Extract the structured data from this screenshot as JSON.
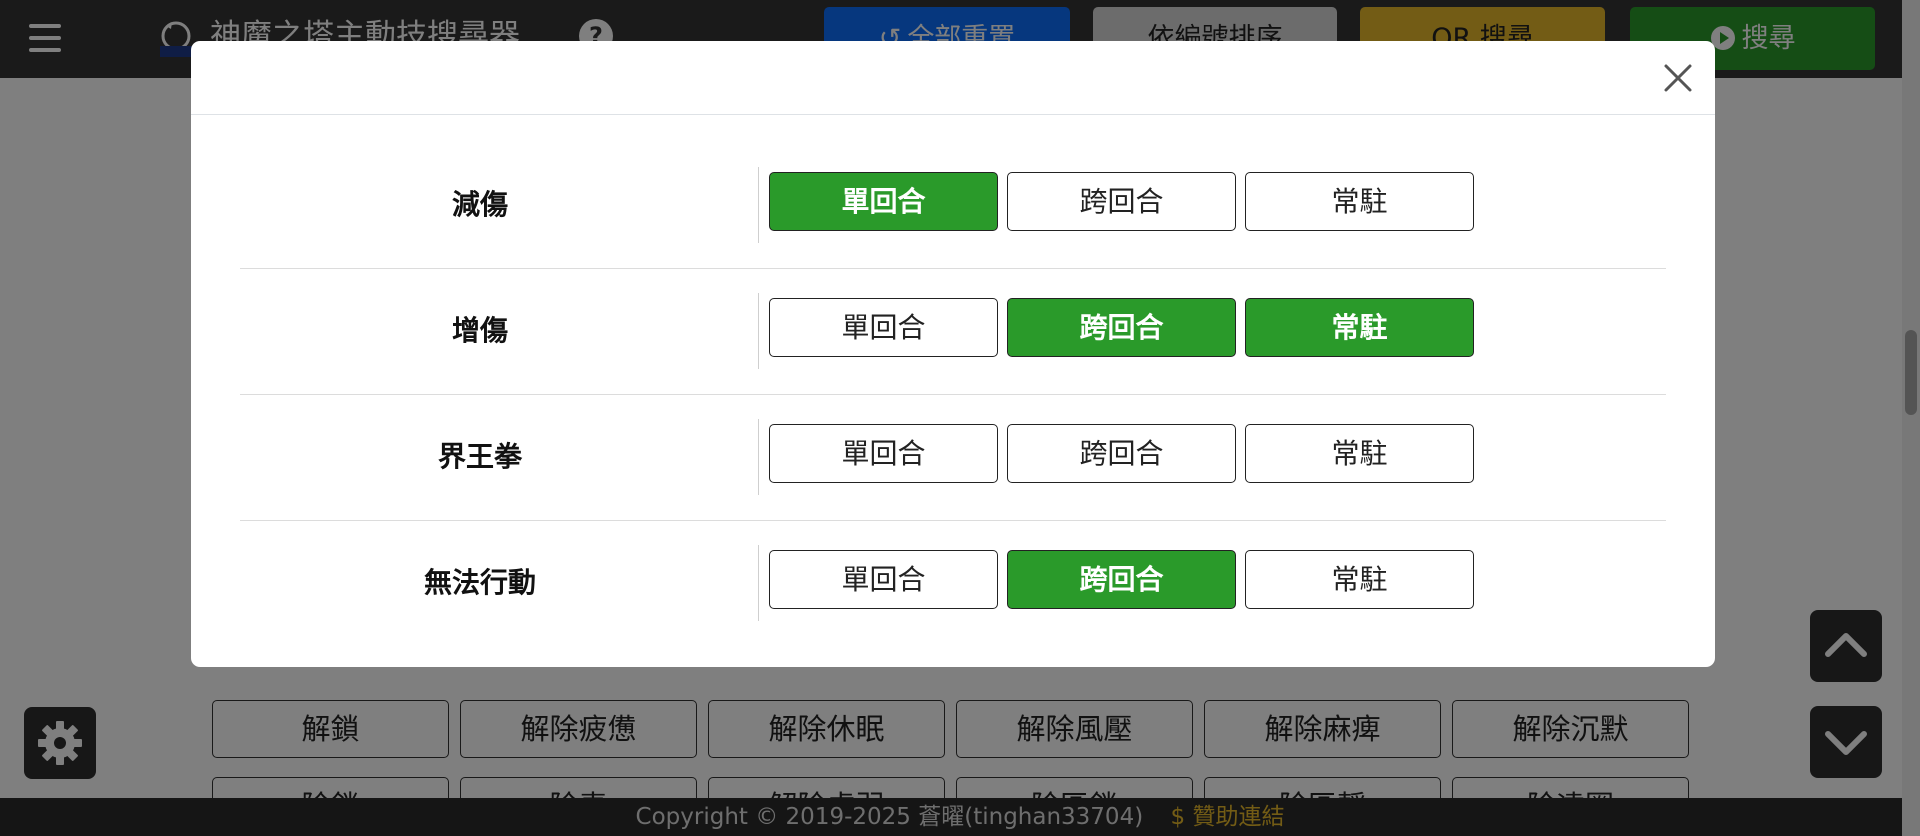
{
  "header": {
    "app_title": "神魔之塔主動技搜尋器",
    "help_symbol": "?",
    "buttons": {
      "reset": "全部重置",
      "sort": "依編號排序",
      "or_search": "OR 搜尋",
      "search": "搜尋"
    }
  },
  "skill_buttons": [
    [
      "解鎖",
      "解除疲憊",
      "解除休眠",
      "解除風壓",
      "解除麻痺",
      "解除沉默"
    ],
    [
      "除鎖",
      "除毒",
      "解除虛弱",
      "除區鎖",
      "除區靜",
      "除遠圈"
    ]
  ],
  "footer": {
    "copyright": "Copyright © 2019-2025 蒼曜(tinghan33704)",
    "sponsor_symbol": "$",
    "sponsor": "贊助連結"
  },
  "modal": {
    "rows": [
      {
        "label": "減傷",
        "options": [
          {
            "label": "單回合",
            "selected": true
          },
          {
            "label": "跨回合",
            "selected": false
          },
          {
            "label": "常駐",
            "selected": false
          }
        ]
      },
      {
        "label": "增傷",
        "options": [
          {
            "label": "單回合",
            "selected": false
          },
          {
            "label": "跨回合",
            "selected": true
          },
          {
            "label": "常駐",
            "selected": true
          }
        ]
      },
      {
        "label": "界王拳",
        "options": [
          {
            "label": "單回合",
            "selected": false
          },
          {
            "label": "跨回合",
            "selected": false
          },
          {
            "label": "常駐",
            "selected": false
          }
        ]
      },
      {
        "label": "無法行動",
        "options": [
          {
            "label": "單回合",
            "selected": false
          },
          {
            "label": "跨回合",
            "selected": true
          },
          {
            "label": "常駐",
            "selected": false
          }
        ]
      }
    ]
  },
  "colors": {
    "selected_green": "#2a9a2a",
    "topbar": "#343434",
    "reset_blue": "#0d6efd",
    "or_yellow": "#e6b82a"
  }
}
